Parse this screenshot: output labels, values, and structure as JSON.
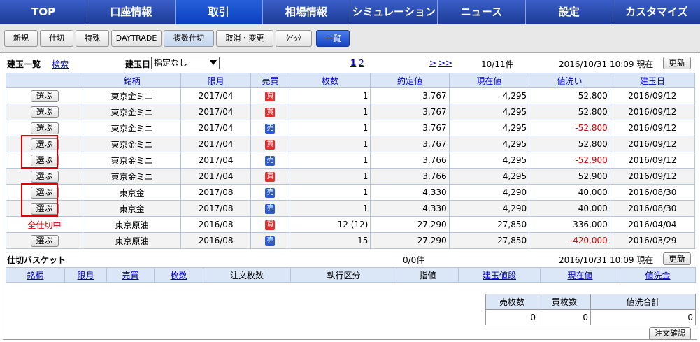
{
  "nav": [
    "TOP",
    "口座情報",
    "取引",
    "相場情報",
    "シミュレーション",
    "ニュース",
    "設定",
    "カスタマイズ"
  ],
  "nav_active": 2,
  "subtabs": [
    "新規",
    "仕切",
    "特殊",
    "DAYTRADE",
    "複数仕切",
    "取消・変更",
    "ｸｲｯｸ"
  ],
  "subtab_ichiran": "一覧",
  "positions": {
    "title": "建玉一覧",
    "search": "検索",
    "date_label": "建玉日",
    "date_select": "指定なし",
    "page1": "1",
    "page2": "2",
    "next": ">",
    "last": ">>",
    "count": "10/11件",
    "time": "2016/10/31 10:09 現在",
    "refresh": "更新",
    "headers": [
      "銘柄",
      "限月",
      "売買",
      "枚数",
      "約定値",
      "現在値",
      "値洗い",
      "建玉日"
    ],
    "select_label": "選ぶ",
    "all_closing": "全仕切中",
    "rows": [
      {
        "name": "東京金ミニ",
        "month": "2017/04",
        "side": "買",
        "qty": "1",
        "price": "3,767",
        "current": "4,295",
        "mtm": "52,800",
        "date": "2016/09/12"
      },
      {
        "name": "東京金ミニ",
        "month": "2017/04",
        "side": "買",
        "qty": "1",
        "price": "3,767",
        "current": "4,295",
        "mtm": "52,800",
        "date": "2016/09/12"
      },
      {
        "name": "東京金ミニ",
        "month": "2017/04",
        "side": "売",
        "qty": "1",
        "price": "3,767",
        "current": "4,295",
        "mtm": "-52,800",
        "date": "2016/09/12"
      },
      {
        "name": "東京金ミニ",
        "month": "2017/04",
        "side": "買",
        "qty": "1",
        "price": "3,767",
        "current": "4,295",
        "mtm": "52,800",
        "date": "2016/09/12"
      },
      {
        "name": "東京金ミニ",
        "month": "2017/04",
        "side": "売",
        "qty": "1",
        "price": "3,766",
        "current": "4,295",
        "mtm": "-52,900",
        "date": "2016/09/12"
      },
      {
        "name": "東京金ミニ",
        "month": "2017/04",
        "side": "買",
        "qty": "1",
        "price": "3,766",
        "current": "4,295",
        "mtm": "52,900",
        "date": "2016/09/12"
      },
      {
        "name": "東京金",
        "month": "2017/08",
        "side": "売",
        "qty": "1",
        "price": "4,330",
        "current": "4,290",
        "mtm": "40,000",
        "date": "2016/08/30"
      },
      {
        "name": "東京金",
        "month": "2017/08",
        "side": "売",
        "qty": "1",
        "price": "4,330",
        "current": "4,290",
        "mtm": "40,000",
        "date": "2016/08/30"
      },
      {
        "name": "東京原油",
        "month": "2016/08",
        "side": "買",
        "qty": "12 (12)",
        "price": "27,290",
        "current": "27,850",
        "mtm": "336,000",
        "date": "2016/04/04"
      },
      {
        "name": "東京原油",
        "month": "2016/08",
        "side": "売",
        "qty": "15",
        "price": "27,290",
        "current": "27,850",
        "mtm": "-420,000",
        "date": "2016/03/29"
      }
    ]
  },
  "basket": {
    "title": "仕切バスケット",
    "count": "0/0件",
    "time": "2016/10/31 10:09 現在",
    "refresh": "更新",
    "headers": [
      "銘柄",
      "限月",
      "売買",
      "枚数",
      "注文枚数",
      "執行区分",
      "指値",
      "建玉値段",
      "現在値",
      "値洗金"
    ],
    "header_links": [
      true,
      true,
      true,
      true,
      false,
      false,
      false,
      true,
      true,
      true
    ]
  },
  "summary": {
    "headers": [
      "売枚数",
      "買枚数",
      "値洗合計"
    ],
    "values": [
      "0",
      "0",
      "0"
    ],
    "confirm": "注文確認"
  },
  "colors": {
    "buy": "#e03030",
    "sell": "#2d5bd6",
    "negative": "#e00000"
  }
}
